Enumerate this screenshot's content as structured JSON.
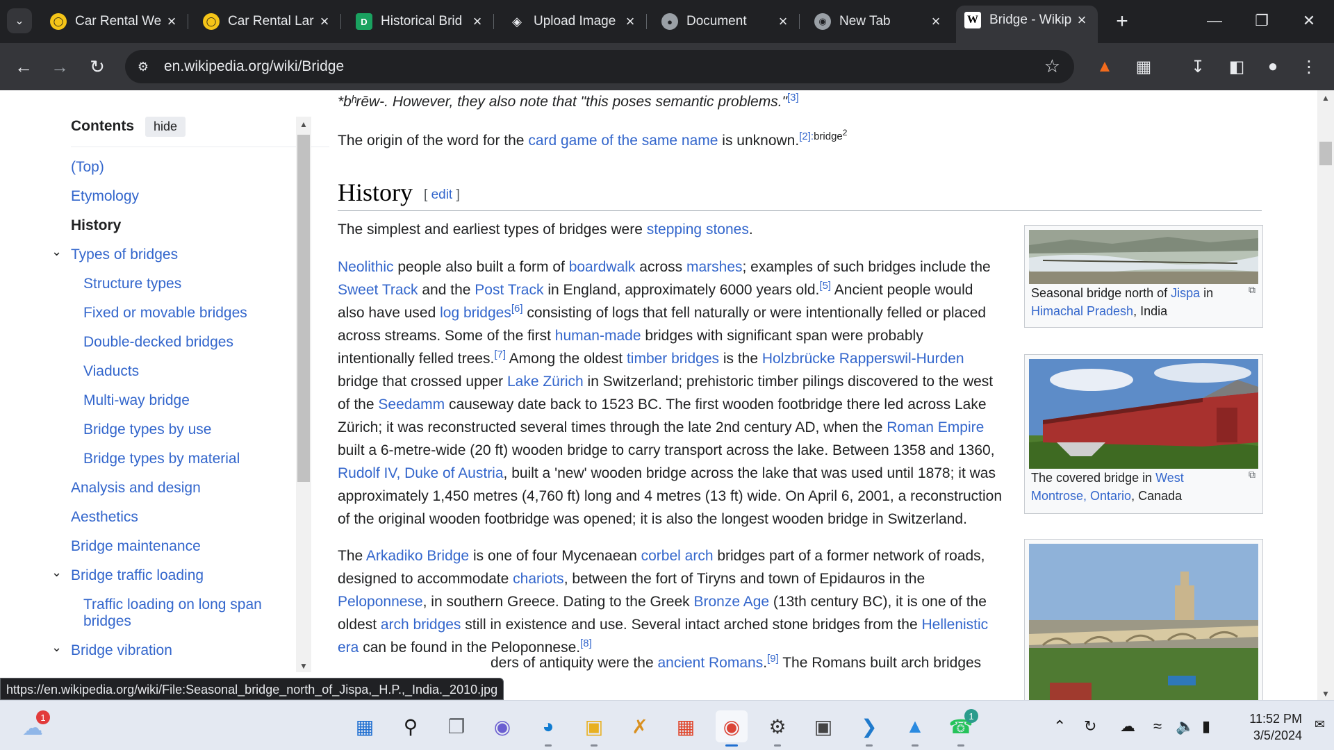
{
  "browser": {
    "tabs": [
      {
        "title": "Car Rental We",
        "icon": "car-rental-favicon",
        "active": false
      },
      {
        "title": "Car Rental Lar",
        "icon": "car-rental-favicon",
        "active": false
      },
      {
        "title": "Historical Brid",
        "icon": "doc-favicon",
        "active": false
      },
      {
        "title": "Upload Image",
        "icon": "upload-favicon",
        "active": false
      },
      {
        "title": "Document",
        "icon": "globe-favicon",
        "active": false
      },
      {
        "title": "New Tab",
        "icon": "chrome-favicon",
        "active": false
      },
      {
        "title": "Bridge - Wikip",
        "icon": "wikipedia-favicon",
        "active": true
      }
    ],
    "url": "en.wikipedia.org/wiki/Bridge",
    "status_url": "https://en.wikipedia.org/wiki/File:Seasonal_bridge_north_of_Jispa,_H.P.,_India._2010.jpg"
  },
  "toc": {
    "heading": "Contents",
    "hide_label": "hide",
    "items": [
      {
        "label": "(Top)"
      },
      {
        "label": "Etymology"
      },
      {
        "label": "History",
        "current": true
      },
      {
        "label": "Types of bridges",
        "expandable": true
      },
      {
        "label": "Structure types"
      },
      {
        "label": "Fixed or movable bridges"
      },
      {
        "label": "Double-decked bridges"
      },
      {
        "label": "Viaducts"
      },
      {
        "label": "Multi-way bridge"
      },
      {
        "label": "Bridge types by use"
      },
      {
        "label": "Bridge types by material"
      },
      {
        "label": "Analysis and design"
      },
      {
        "label": "Aesthetics"
      },
      {
        "label": "Bridge maintenance"
      },
      {
        "label": "Bridge traffic loading",
        "expandable": true
      },
      {
        "label": "Traffic loading on long span"
      },
      {
        "label": "bridges"
      },
      {
        "label": "Bridge vibration",
        "expandable": true
      }
    ]
  },
  "article": {
    "p0": {
      "a": "*bʰrēw-. However, they also note that \"this poses semantic problems.\"",
      "ref": "[3]"
    },
    "p1": {
      "a": "The origin of the word for the ",
      "link": "card game of the same name",
      "b": " is unknown.",
      "ref": "[2]:",
      "ref2": "bridge",
      "sup2": "2"
    },
    "heading": "History",
    "edit_label": "edit",
    "p2": {
      "a": "The simplest and earliest types of bridges were ",
      "link": "stepping stones",
      "b": "."
    },
    "p3_lines": [
      [
        [
          "l",
          "Neolithic"
        ],
        [
          "t",
          " people also built a form of "
        ],
        [
          "l",
          "boardwalk"
        ],
        [
          "t",
          " across "
        ],
        [
          "l",
          "marshes"
        ],
        [
          "t",
          "; examples of such bridges include the"
        ]
      ],
      [
        [
          "l",
          "Sweet Track"
        ],
        [
          "t",
          " and the "
        ],
        [
          "l",
          "Post Track"
        ],
        [
          "t",
          " in England, approximately 6000 years old."
        ],
        [
          "s",
          "[5]"
        ],
        [
          "t",
          " Ancient people would"
        ]
      ],
      [
        [
          "t",
          "also have used "
        ],
        [
          "l",
          "log bridges"
        ],
        [
          "s",
          "[6]"
        ],
        [
          "t",
          " consisting of logs that fell naturally or were intentionally felled or placed"
        ]
      ],
      [
        [
          "t",
          "across streams. Some of the first "
        ],
        [
          "l",
          "human-made"
        ],
        [
          "t",
          " bridges with significant span were probably"
        ]
      ],
      [
        [
          "t",
          "intentionally felled trees."
        ],
        [
          "s",
          "[7]"
        ],
        [
          "t",
          " Among the oldest "
        ],
        [
          "l",
          "timber bridges"
        ],
        [
          "t",
          " is the "
        ],
        [
          "l",
          "Holzbrücke Rapperswil-Hurden"
        ]
      ],
      [
        [
          "t",
          "bridge that crossed upper "
        ],
        [
          "l",
          "Lake Zürich"
        ],
        [
          "t",
          " in Switzerland; prehistoric timber pilings discovered to the west"
        ]
      ],
      [
        [
          "t",
          "of the "
        ],
        [
          "l",
          "Seedamm"
        ],
        [
          "t",
          " causeway date back to 1523 BC. The first wooden footbridge there led across Lake"
        ]
      ],
      [
        [
          "t",
          "Zürich; it was reconstructed several times through the late 2nd century AD, when the "
        ],
        [
          "l",
          "Roman Empire"
        ]
      ],
      [
        [
          "t",
          "built a 6-metre-wide (20 ft) wooden bridge to carry transport across the lake. Between 1358 and 1360,"
        ]
      ],
      [
        [
          "l",
          "Rudolf IV, Duke of Austria"
        ],
        [
          "t",
          ", built a 'new' wooden bridge across the lake that was used until 1878; it was"
        ]
      ],
      [
        [
          "t",
          "approximately 1,450 metres (4,760 ft) long and 4 metres (13 ft) wide. On April 6, 2001, a reconstruction"
        ]
      ],
      [
        [
          "t",
          "of the original wooden footbridge was opened; it is also the longest wooden bridge in Switzerland."
        ]
      ]
    ],
    "p4_lines": [
      [
        [
          "t",
          "The "
        ],
        [
          "l",
          "Arkadiko Bridge"
        ],
        [
          "t",
          " is one of four Mycenaean "
        ],
        [
          "l",
          "corbel arch"
        ],
        [
          "t",
          " bridges part of a former network of roads,"
        ]
      ],
      [
        [
          "t",
          "designed to accommodate "
        ],
        [
          "l",
          "chariots"
        ],
        [
          "t",
          ", between the fort of Tiryns and town of Epidauros in the"
        ]
      ],
      [
        [
          "l",
          "Peloponnese"
        ],
        [
          "t",
          ", in southern Greece. Dating to the Greek "
        ],
        [
          "l",
          "Bronze Age"
        ],
        [
          "t",
          " (13th century BC), it is one of the"
        ]
      ],
      [
        [
          "t",
          "oldest "
        ],
        [
          "l",
          "arch bridges"
        ],
        [
          "t",
          " still in existence and use. Several intact arched stone bridges from the "
        ],
        [
          "l",
          "Hellenistic"
        ]
      ],
      [
        [
          "l",
          "era"
        ],
        [
          "t",
          " can be found in the Peloponnese."
        ],
        [
          "s",
          "[8]"
        ]
      ]
    ],
    "p5_visible": [
      [
        "t",
        "ders of antiquity were the "
      ],
      [
        "l",
        "ancient Romans"
      ],
      [
        "t",
        "."
      ],
      [
        "s",
        "[9]"
      ],
      [
        "t",
        " The Romans built arch bridges"
      ]
    ],
    "figures": [
      {
        "cap_a": "Seasonal bridge north of ",
        "cap_link1": "Jispa",
        "cap_b": " in",
        "cap_link2": "Himachal Pradesh",
        "cap_c": ", India"
      },
      {
        "cap_a": "The covered bridge in ",
        "cap_link1": "West",
        "cap_link2": "Montrose, Ontario",
        "cap_c": ", Canada"
      }
    ]
  },
  "taskbar": {
    "time": "11:52 PM",
    "date": "3/5/2024",
    "weather_badge": "1",
    "whatsapp_badge": "1",
    "colors": {
      "accent": "#1f6fd1",
      "link": "#3366cc"
    }
  }
}
